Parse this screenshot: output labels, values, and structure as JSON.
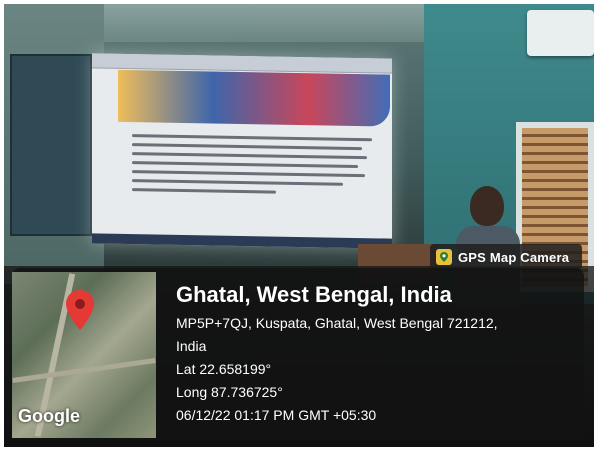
{
  "badge": {
    "icon": "map-pin-icon",
    "label": "GPS Map Camera"
  },
  "location": {
    "title": "Ghatal, West Bengal, India",
    "address_line1": "MP5P+7QJ, Kuspata, Ghatal, West Bengal 721212,",
    "address_line2": "India",
    "latitude": "Lat 22.658199°",
    "longitude": "Long 87.736725°",
    "timestamp": "06/12/22 01:17 PM GMT +05:30"
  },
  "map": {
    "brand": "Google",
    "pin_color": "#e53935"
  },
  "colors": {
    "overlay": "#121212",
    "badge_icon": "#e8c23a"
  }
}
